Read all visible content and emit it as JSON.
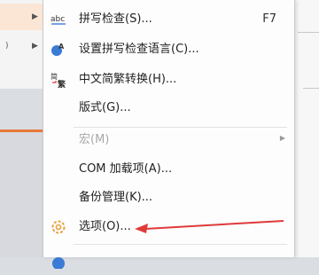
{
  "menu": {
    "items": [
      {
        "label": "拼写检查(S)...",
        "shortcut": "F7",
        "icon": "spellcheck-icon"
      },
      {
        "label": "设置拼写检查语言(C)...",
        "icon": "language-icon"
      },
      {
        "label": "中文简繁转换(H)...",
        "icon": "chinese-convert-icon"
      },
      {
        "label": "版式(G)..."
      },
      {
        "label": "宏(M)",
        "disabled": true,
        "submenu": true
      },
      {
        "label": "COM 加载项(A)..."
      },
      {
        "label": "备份管理(K)..."
      },
      {
        "label": "选项(O)...",
        "icon": "gear-icon"
      },
      {
        "label": "",
        "icon": "partial-icon"
      }
    ]
  },
  "colors": {
    "accent": "#e87838",
    "arrow": "#e03a3a"
  }
}
